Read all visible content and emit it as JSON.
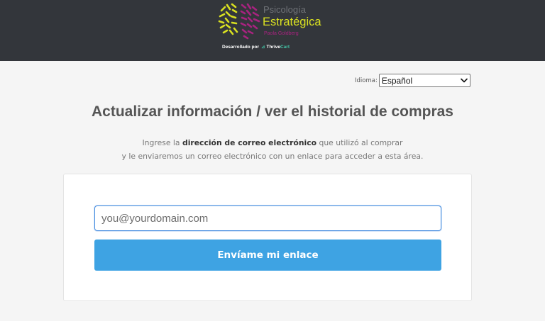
{
  "header": {
    "logo": {
      "line1": "Psicología",
      "line2": "Estratégica",
      "line3": "Paola Goldberg",
      "colors": {
        "green": "#d9e021",
        "magenta": "#a8237f",
        "gray": "#6f7277"
      },
      "icon": "brain-logo-icon"
    },
    "powered_by": {
      "prefix": "Desarrollado por",
      "brand_first": "Thrive",
      "brand_second": "Cart",
      "icon": "thrivecart-logo-icon"
    },
    "background": "#33363b"
  },
  "language": {
    "label": "Idioma:",
    "selected": "Español",
    "icon": "chevron-down-icon"
  },
  "main": {
    "title": "Actualizar información / ver el historial de compras",
    "desc_line1_pre": "Ingrese la ",
    "desc_line1_bold": "dirección de correo electrónico",
    "desc_line1_post": " que utilizó al comprar",
    "desc_line2": "y le enviaremos un correo electrónico con un enlace para acceder a esta área."
  },
  "form": {
    "email_placeholder": "you@yourdomain.com",
    "email_value": "",
    "submit_label": "Envíame mi enlace",
    "accent": "#3ea3e3"
  }
}
